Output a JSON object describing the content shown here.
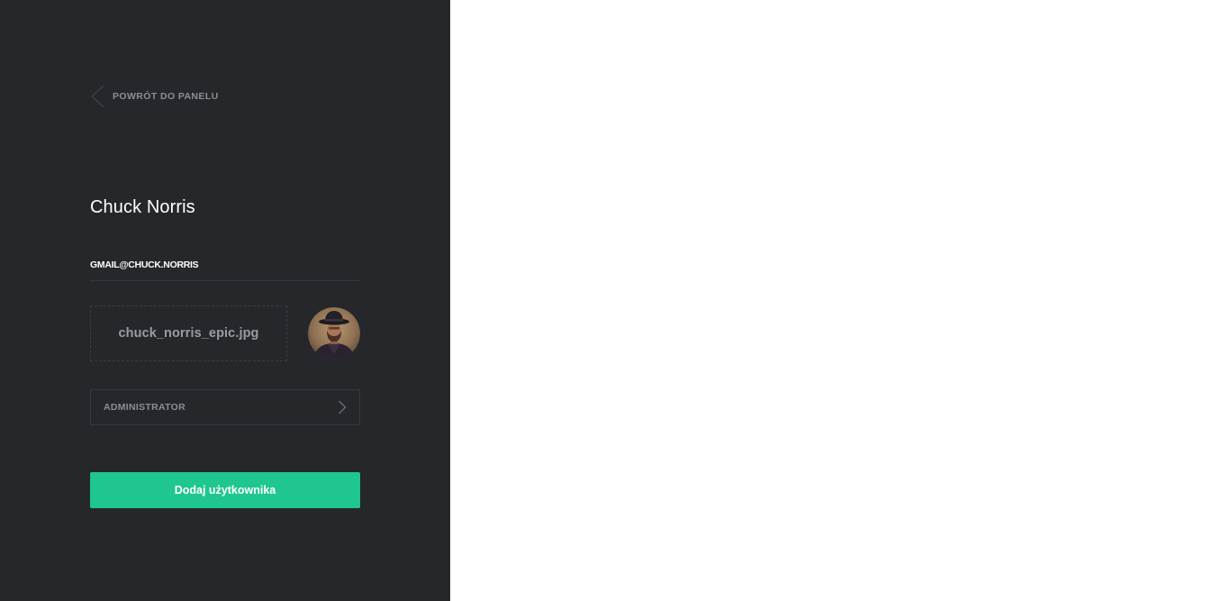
{
  "sidebar": {
    "back_link": {
      "label": "POWRÓT DO PANELU",
      "icon": "chevron-left-icon"
    },
    "user": {
      "name": "Chuck Norris",
      "email": "GMAIL@CHUCK.NORRIS"
    },
    "avatar_upload": {
      "file_name": "chuck_norris_epic.jpg",
      "avatar_icon": "user-avatar-photo"
    },
    "role": {
      "selected": "ADMINISTRATOR",
      "icon": "chevron-right-icon"
    },
    "submit": {
      "label": "Dodaj użytkownika"
    }
  },
  "colors": {
    "sidebar_bg": "#26272b",
    "main_bg": "#ffffff",
    "accent": "#1fc68f",
    "muted_text": "#8b8d93",
    "border": "#36383d"
  }
}
